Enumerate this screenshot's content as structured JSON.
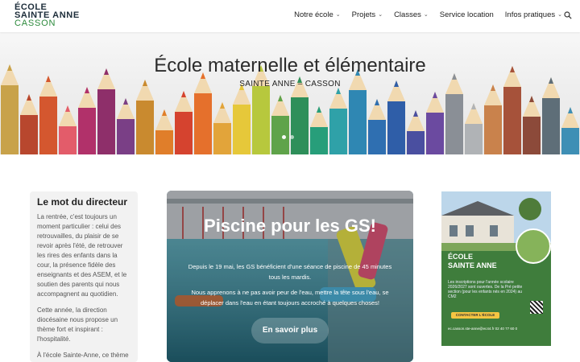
{
  "logo": {
    "line1": "ÉCOLE",
    "line2": "SAINTE ANNE",
    "line3": "CASSON"
  },
  "nav": {
    "items": [
      {
        "label": "Notre école",
        "has_dropdown": true
      },
      {
        "label": "Projets",
        "has_dropdown": true
      },
      {
        "label": "Classes",
        "has_dropdown": true
      },
      {
        "label": "Service location",
        "has_dropdown": false
      },
      {
        "label": "Infos pratiques",
        "has_dropdown": true
      }
    ],
    "search_icon": "search-icon"
  },
  "hero": {
    "title": "École maternelle et élémentaire",
    "subtitle": "SAINTE ANNE – CASSON",
    "slide_count": 2,
    "active_slide": 1
  },
  "director": {
    "heading": "Le mot du directeur",
    "paragraphs": [
      "La rentrée, c'est toujours un moment particulier : celui des retrouvailles, du plaisir de se revoir après l'été, de retrouver les rires des enfants dans la cour, la présence fidèle des enseignants et des ASEM, et le soutien des parents qui nous accompagnent au quotidien.",
      "Cette année, la direction diocésaine nous propose un thème fort et inspirant : l'hospitalité.",
      "À l'école Sainte-Anne, ce thème prend tout son sens"
    ]
  },
  "card": {
    "title": "Piscine pour les GS!",
    "text1": "Depuis le 19 mai, les GS bénéficient d'une séance de piscine de 45 minutes tous les mardis.",
    "text2": "Nous apprenons à ne pas avoir peur de l'eau, mettre la tête sous l'eau, se déplacer dans l'eau en étant toujours accroché à quelques choses!",
    "button": "En savoir plus"
  },
  "poster": {
    "title1": "ÉCOLE",
    "title2": "SAINTE ANNE",
    "info": "Les inscriptions pour l'année scolaire 2026/2027 sont ouvertes. De la Pré petite section (pour les enfants nés en 2024) au CM2",
    "button": "CONTACTER L'ÉCOLE",
    "footer": "ec.casson.ste-anne@ec44.fr      02 40 77 60 0"
  }
}
